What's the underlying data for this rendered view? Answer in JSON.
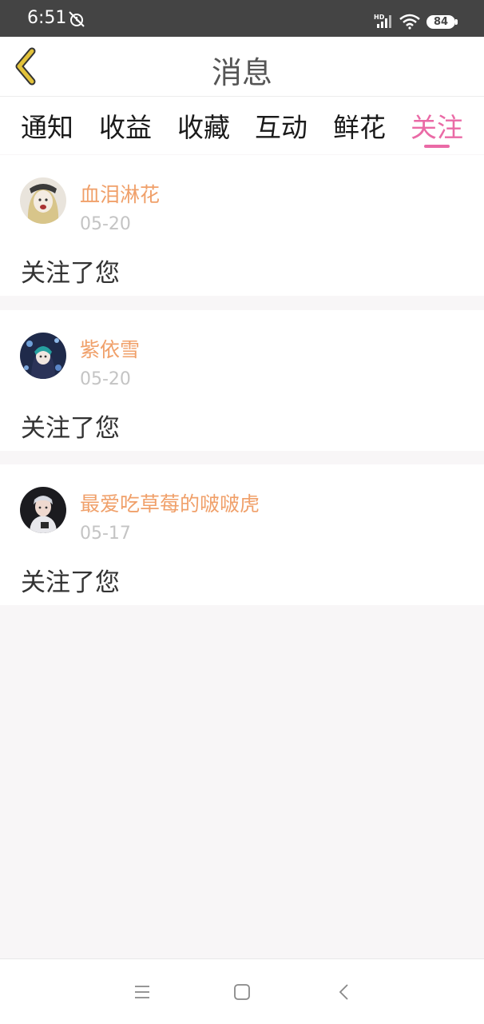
{
  "status_bar": {
    "time": "6:51",
    "network": "HD",
    "battery": "84",
    "icons": [
      "alarm-off-icon",
      "signal-icon",
      "wifi-icon",
      "battery-icon"
    ]
  },
  "header": {
    "title": "消息",
    "back_icon": "chevron-left-icon"
  },
  "tabs": [
    {
      "label": "通知",
      "active": false
    },
    {
      "label": "收益",
      "active": false
    },
    {
      "label": "收藏",
      "active": false
    },
    {
      "label": "互动",
      "active": false
    },
    {
      "label": "鲜花",
      "active": false
    },
    {
      "label": "关注",
      "active": true
    }
  ],
  "notifications": [
    {
      "username": "血泪淋花",
      "date": "05-20",
      "message": "关注了您",
      "avatar": "avatar-icon"
    },
    {
      "username": "紫依雪",
      "date": "05-20",
      "message": "关注了您",
      "avatar": "avatar-icon"
    },
    {
      "username": "最爱吃草莓的啵啵虎",
      "date": "05-17",
      "message": "关注了您",
      "avatar": "avatar-icon"
    }
  ],
  "system_nav": {
    "icons": [
      "menu-icon",
      "home-icon",
      "back-icon"
    ]
  },
  "colors": {
    "accent": "#ea6aa6",
    "username": "#f0a06a",
    "back_arrow": "#e2c23a",
    "status_bar": "#444444"
  }
}
